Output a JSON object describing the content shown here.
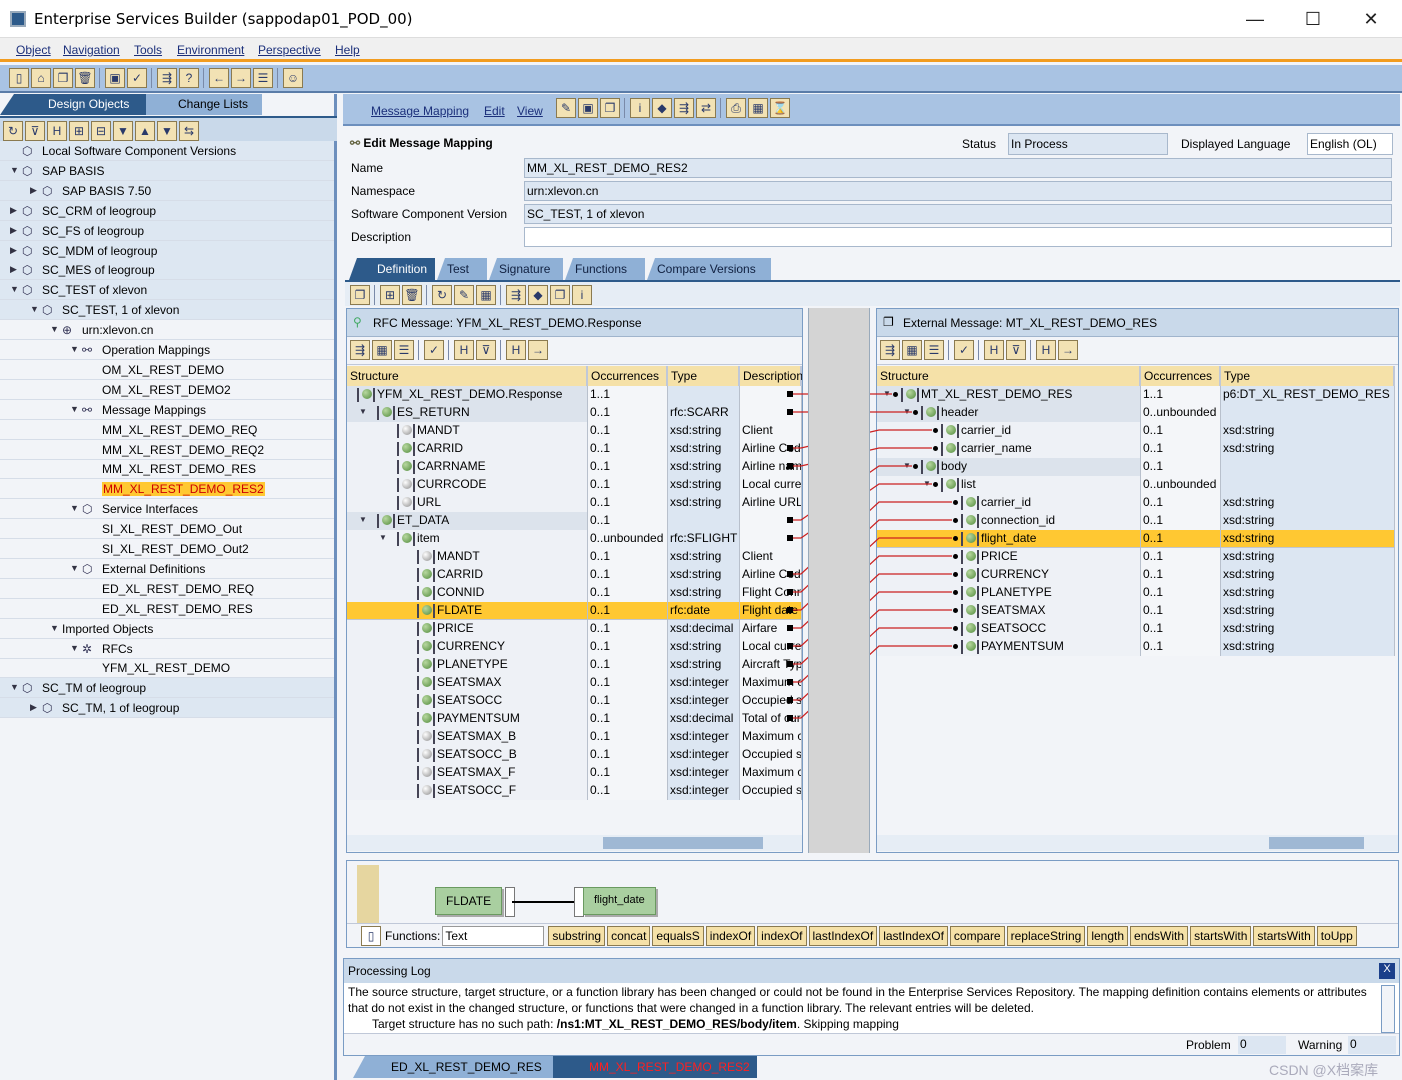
{
  "window": {
    "title": "Enterprise Services Builder (sappodap01_POD_00)",
    "minimize": "—",
    "maximize": "☐",
    "close": "✕"
  },
  "menu": [
    "Object",
    "Navigation",
    "Tools",
    "Environment",
    "Perspective",
    "Help"
  ],
  "main_toolbar_icons": [
    "new-icon",
    "open-icon",
    "copy-icon",
    "delete-icon",
    "sep",
    "save-icon",
    "check-icon",
    "sep",
    "navigate-icon",
    "where-used-icon",
    "sep",
    "back-icon",
    "forward-icon",
    "list-icon",
    "sep",
    "user-icon"
  ],
  "left_panel": {
    "tabs": [
      "Design Objects",
      "Change Lists"
    ],
    "toolbar_icons": [
      "refresh-icon",
      "filter-icon",
      "find-icon",
      "expand-icon",
      "collapse-icon",
      "down-icon",
      "up-icon",
      "funnel-icon",
      "sync-icon"
    ],
    "tree": [
      {
        "label": "Local Software Component Versions",
        "level": 0,
        "exp": "",
        "icon": "package-icon"
      },
      {
        "label": "SAP BASIS",
        "level": 0,
        "exp": "open",
        "icon": "swc-icon"
      },
      {
        "label": "SAP BASIS 7.50",
        "level": 1,
        "exp": "closed",
        "icon": "swcv-icon"
      },
      {
        "label": "SC_CRM of leogroup",
        "level": 0,
        "exp": "closed",
        "icon": "swc-icon"
      },
      {
        "label": "SC_FS of leogroup",
        "level": 0,
        "exp": "closed",
        "icon": "swc-icon"
      },
      {
        "label": "SC_MDM of leogroup",
        "level": 0,
        "exp": "closed",
        "icon": "swc-icon"
      },
      {
        "label": "SC_MES of leogroup",
        "level": 0,
        "exp": "closed",
        "icon": "swc-icon"
      },
      {
        "label": "SC_TEST of xlevon",
        "level": 0,
        "exp": "open",
        "icon": "swc-icon"
      },
      {
        "label": "SC_TEST, 1 of xlevon",
        "level": 1,
        "exp": "open",
        "icon": "swcv-icon"
      },
      {
        "label": "urn:xlevon.cn",
        "level": 2,
        "exp": "open",
        "icon": "namespace-icon"
      },
      {
        "label": "Operation Mappings",
        "level": 3,
        "exp": "open",
        "icon": "mapping-icon"
      },
      {
        "label": "OM_XL_REST_DEMO",
        "level": 4,
        "exp": "",
        "icon": ""
      },
      {
        "label": "OM_XL_REST_DEMO2",
        "level": 4,
        "exp": "",
        "icon": ""
      },
      {
        "label": "Message Mappings",
        "level": 3,
        "exp": "open",
        "icon": "mapping-icon"
      },
      {
        "label": "MM_XL_REST_DEMO_REQ",
        "level": 4,
        "exp": "",
        "icon": ""
      },
      {
        "label": "MM_XL_REST_DEMO_REQ2",
        "level": 4,
        "exp": "",
        "icon": ""
      },
      {
        "label": "MM_XL_REST_DEMO_RES",
        "level": 4,
        "exp": "",
        "icon": ""
      },
      {
        "label": "MM_XL_REST_DEMO_RES2",
        "level": 4,
        "exp": "",
        "icon": "",
        "selected": true
      },
      {
        "label": "Service Interfaces",
        "level": 3,
        "exp": "open",
        "icon": "interface-icon"
      },
      {
        "label": "SI_XL_REST_DEMO_Out",
        "level": 4,
        "exp": "",
        "icon": ""
      },
      {
        "label": "SI_XL_REST_DEMO_Out2",
        "level": 4,
        "exp": "",
        "icon": ""
      },
      {
        "label": "External Definitions",
        "level": 3,
        "exp": "open",
        "icon": "external-definition-icon"
      },
      {
        "label": "ED_XL_REST_DEMO_REQ",
        "level": 4,
        "exp": "",
        "icon": ""
      },
      {
        "label": "ED_XL_REST_DEMO_RES",
        "level": 4,
        "exp": "",
        "icon": ""
      },
      {
        "label": "Imported Objects",
        "level": 2,
        "exp": "open",
        "icon": "none"
      },
      {
        "label": "RFCs",
        "level": 3,
        "exp": "open",
        "icon": "rfc-icon"
      },
      {
        "label": "YFM_XL_REST_DEMO",
        "level": 4,
        "exp": "",
        "icon": ""
      },
      {
        "label": "SC_TM of leogroup",
        "level": 0,
        "exp": "open",
        "icon": "swc-icon"
      },
      {
        "label": "SC_TM, 1 of leogroup",
        "level": 1,
        "exp": "closed",
        "icon": "swcv-icon"
      }
    ]
  },
  "editor": {
    "menu": [
      "Message Mapping",
      "Edit",
      "View"
    ],
    "toolbar_icons": [
      "edit-icon",
      "save-icon",
      "copy-icon",
      "sep",
      "info-icon",
      "erase-icon",
      "navigate-icon",
      "transport-icon",
      "sep",
      "print-icon",
      "table-icon",
      "history-icon"
    ],
    "heading": "Edit Message Mapping",
    "status_label": "Status",
    "status_value": "In Process",
    "language_label": "Displayed Language",
    "language_value": "English (OL)",
    "fields": [
      {
        "label": "Name",
        "value": "MM_XL_REST_DEMO_RES2"
      },
      {
        "label": "Namespace",
        "value": "urn:xlevon.cn"
      },
      {
        "label": "Software Component Version",
        "value": "SC_TEST, 1 of xlevon"
      },
      {
        "label": "Description",
        "value": ""
      }
    ],
    "tabs": [
      "Definition",
      "Test",
      "Signature",
      "Functions",
      "Compare Versions"
    ],
    "active_tab": "Definition"
  },
  "source": {
    "title": "RFC Message: YFM_XL_REST_DEMO.Response",
    "columns": [
      "Structure",
      "Occurrences",
      "Type",
      "Description"
    ],
    "rows": [
      {
        "name": "YFM_XL_REST_DEMO.Response",
        "level": 0,
        "exp": true,
        "ball": "g",
        "occ": "1..1",
        "type": "",
        "desc": ""
      },
      {
        "name": "ES_RETURN",
        "level": 1,
        "exp": true,
        "ball": "g",
        "occ": "0..1",
        "type": "rfc:SCARR",
        "desc": ""
      },
      {
        "name": "MANDT",
        "level": 2,
        "ball": "w",
        "occ": "0..1",
        "type": "xsd:string",
        "desc": "Client"
      },
      {
        "name": "CARRID",
        "level": 2,
        "ball": "g",
        "occ": "0..1",
        "type": "xsd:string",
        "desc": "Airline Code"
      },
      {
        "name": "CARRNAME",
        "level": 2,
        "ball": "g",
        "occ": "0..1",
        "type": "xsd:string",
        "desc": "Airline name"
      },
      {
        "name": "CURRCODE",
        "level": 2,
        "ball": "w",
        "occ": "0..1",
        "type": "xsd:string",
        "desc": "Local currency"
      },
      {
        "name": "URL",
        "level": 2,
        "ball": "w",
        "occ": "0..1",
        "type": "xsd:string",
        "desc": "Airline URL"
      },
      {
        "name": "ET_DATA",
        "level": 1,
        "exp": true,
        "ball": "g",
        "occ": "0..1",
        "type": "",
        "desc": ""
      },
      {
        "name": "item",
        "level": 2,
        "exp": true,
        "ball": "g",
        "occ": "0..unbounded",
        "type": "rfc:SFLIGHT",
        "desc": ""
      },
      {
        "name": "MANDT",
        "level": 3,
        "ball": "w",
        "occ": "0..1",
        "type": "xsd:string",
        "desc": "Client"
      },
      {
        "name": "CARRID",
        "level": 3,
        "ball": "g",
        "occ": "0..1",
        "type": "xsd:string",
        "desc": "Airline Code"
      },
      {
        "name": "CONNID",
        "level": 3,
        "ball": "g",
        "occ": "0..1",
        "type": "xsd:string",
        "desc": "Flight Connection"
      },
      {
        "name": "FLDATE",
        "level": 3,
        "ball": "g",
        "occ": "0..1",
        "type": "rfc:date",
        "desc": "Flight date",
        "selected": true
      },
      {
        "name": "PRICE",
        "level": 3,
        "ball": "g",
        "occ": "0..1",
        "type": "xsd:decimal",
        "desc": "Airfare"
      },
      {
        "name": "CURRENCY",
        "level": 3,
        "ball": "g",
        "occ": "0..1",
        "type": "xsd:string",
        "desc": "Local currency"
      },
      {
        "name": "PLANETYPE",
        "level": 3,
        "ball": "g",
        "occ": "0..1",
        "type": "xsd:string",
        "desc": "Aircraft Type"
      },
      {
        "name": "SEATSMAX",
        "level": 3,
        "ball": "g",
        "occ": "0..1",
        "type": "xsd:integer",
        "desc": "Maximum capacity"
      },
      {
        "name": "SEATSOCC",
        "level": 3,
        "ball": "g",
        "occ": "0..1",
        "type": "xsd:integer",
        "desc": "Occupied seats"
      },
      {
        "name": "PAYMENTSUM",
        "level": 3,
        "ball": "g",
        "occ": "0..1",
        "type": "xsd:decimal",
        "desc": "Total of current bookings"
      },
      {
        "name": "SEATSMAX_B",
        "level": 3,
        "ball": "w",
        "occ": "0..1",
        "type": "xsd:integer",
        "desc": "Maximum capacity"
      },
      {
        "name": "SEATSOCC_B",
        "level": 3,
        "ball": "w",
        "occ": "0..1",
        "type": "xsd:integer",
        "desc": "Occupied seats"
      },
      {
        "name": "SEATSMAX_F",
        "level": 3,
        "ball": "w",
        "occ": "0..1",
        "type": "xsd:integer",
        "desc": "Maximum capacity"
      },
      {
        "name": "SEATSOCC_F",
        "level": 3,
        "ball": "w",
        "occ": "0..1",
        "type": "xsd:integer",
        "desc": "Occupied seats"
      }
    ]
  },
  "target": {
    "title": "External Message: MT_XL_REST_DEMO_RES",
    "columns": [
      "Structure",
      "Occurrences",
      "Type"
    ],
    "rows": [
      {
        "name": "MT_XL_REST_DEMO_RES",
        "level": 0,
        "exp": true,
        "occ": "1..1",
        "type": "p6:DT_XL_REST_DEMO_RES"
      },
      {
        "name": "header",
        "level": 1,
        "exp": true,
        "occ": "0..unbounded",
        "type": ""
      },
      {
        "name": "carrier_id",
        "level": 2,
        "occ": "0..1",
        "type": "xsd:string"
      },
      {
        "name": "carrier_name",
        "level": 2,
        "occ": "0..1",
        "type": "xsd:string"
      },
      {
        "name": "body",
        "level": 1,
        "exp": true,
        "occ": "0..1",
        "type": ""
      },
      {
        "name": "list",
        "level": 2,
        "exp": true,
        "occ": "0..unbounded",
        "type": ""
      },
      {
        "name": "carrier_id",
        "level": 3,
        "occ": "0..1",
        "type": "xsd:string"
      },
      {
        "name": "connection_id",
        "level": 3,
        "occ": "0..1",
        "type": "xsd:string"
      },
      {
        "name": "flight_date",
        "level": 3,
        "occ": "0..1",
        "type": "xsd:string",
        "selected": true
      },
      {
        "name": "PRICE",
        "level": 3,
        "occ": "0..1",
        "type": "xsd:string"
      },
      {
        "name": "CURRENCY",
        "level": 3,
        "occ": "0..1",
        "type": "xsd:string"
      },
      {
        "name": "PLANETYPE",
        "level": 3,
        "occ": "0..1",
        "type": "xsd:string"
      },
      {
        "name": "SEATSMAX",
        "level": 3,
        "occ": "0..1",
        "type": "xsd:string"
      },
      {
        "name": "SEATSOCC",
        "level": 3,
        "occ": "0..1",
        "type": "xsd:string"
      },
      {
        "name": "PAYMENTSUM",
        "level": 3,
        "occ": "0..1",
        "type": "xsd:string"
      }
    ]
  },
  "mappings": [
    [
      0,
      0
    ],
    [
      1,
      1
    ],
    [
      3,
      2
    ],
    [
      4,
      3
    ],
    [
      7,
      4
    ],
    [
      8,
      5
    ],
    [
      10,
      6
    ],
    [
      11,
      7
    ],
    [
      12,
      8
    ],
    [
      13,
      9
    ],
    [
      14,
      10
    ],
    [
      15,
      11
    ],
    [
      16,
      12
    ],
    [
      17,
      13
    ],
    [
      18,
      14
    ]
  ],
  "mapping_line_color": "#cc2020",
  "selected_color": "#ffc832",
  "graph": {
    "source_node": "FLDATE",
    "target_node": "flight_date"
  },
  "functions": {
    "label": "Functions:",
    "category": "Text",
    "buttons": [
      "substring",
      "concat",
      "equalsS",
      "indexOf",
      "indexOf",
      "lastIndexOf",
      "lastIndexOf",
      "compare",
      "replaceString",
      "length",
      "endsWith",
      "startsWith",
      "startsWith",
      "toUpp"
    ]
  },
  "log": {
    "title": "Processing Log",
    "message": "The source structure, target structure, or a function library has been changed or could not be found in the Enterprise Services Repository. The mapping definition contains elements or attributes that do not exist in the changed structure, or functions that were changed in a function library. The relevant entries will be deleted.",
    "detail_prefix": "Target structure has no such path: ",
    "detail_path": "/ns1:MT_XL_REST_DEMO_RES/body/item",
    "detail_suffix": ". Skipping mapping",
    "problem_label": "Problem",
    "problem_value": "0",
    "warning_label": "Warning",
    "warning_value": "0"
  },
  "bottom_tabs": [
    "ED_XL_REST_DEMO_RES",
    "MM_XL_REST_DEMO_RES2"
  ],
  "watermark": "CSDN @X档案库"
}
